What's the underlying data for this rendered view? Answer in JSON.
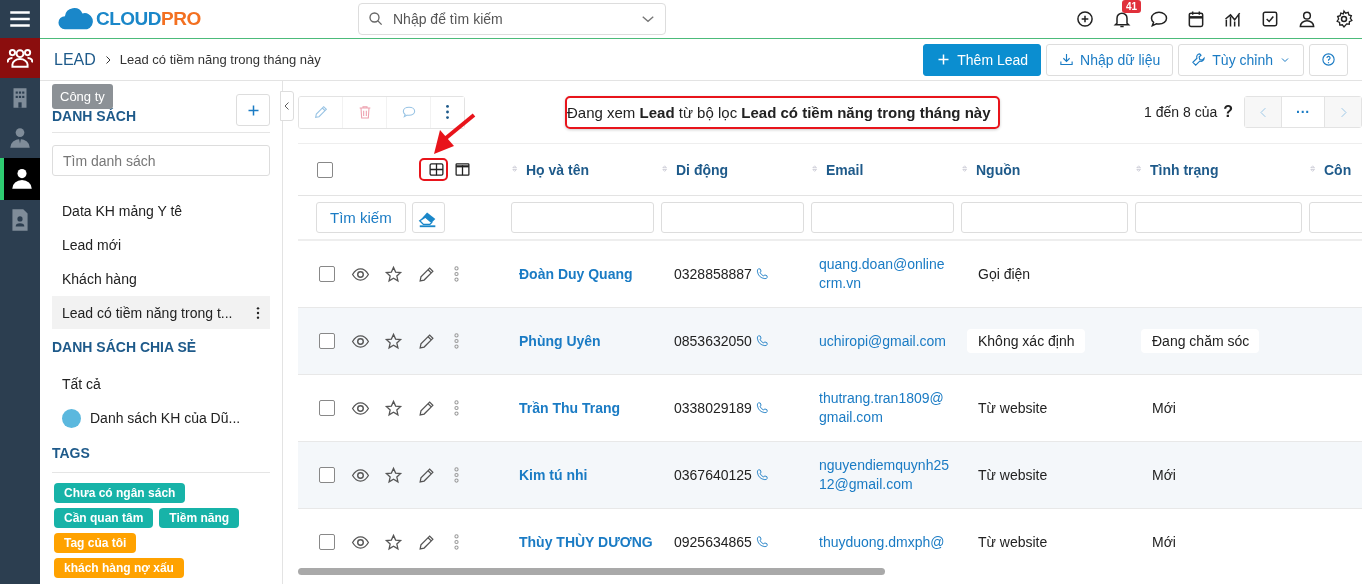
{
  "rail": [
    {
      "kind": "menu",
      "selected": false
    },
    {
      "kind": "leads",
      "selected": false,
      "highlighted": true
    },
    {
      "kind": "company",
      "selected": false
    },
    {
      "kind": "contact",
      "selected": false
    },
    {
      "kind": "person",
      "selected": true
    },
    {
      "kind": "document",
      "selected": false
    }
  ],
  "tooltip": "Công ty",
  "logo": {
    "text": "CLOUD",
    "accent": "PRO"
  },
  "search": {
    "placeholder": "Nhập để tìm kiếm"
  },
  "notifications": {
    "count": "41"
  },
  "breadcrumb": {
    "module": "LEAD",
    "current": "Lead có tiềm năng trong tháng này"
  },
  "actions": [
    {
      "kind": "add",
      "label": "Thêm Lead"
    },
    {
      "kind": "import",
      "label": "Nhập dữ liệu"
    },
    {
      "kind": "customize",
      "label": "Tùy chỉnh",
      "dropdown": true
    },
    {
      "kind": "help"
    }
  ],
  "sidebar": {
    "lists_title": "DANH SÁCH",
    "list_search": {
      "placeholder": "Tìm danh sách"
    },
    "lists": [
      {
        "label": "Data KH mảng Y tê",
        "selected": false
      },
      {
        "label": "Lead mới",
        "selected": false
      },
      {
        "label": "Khách hàng",
        "selected": false
      },
      {
        "label": "Lead có tiềm năng trong t...",
        "selected": true
      }
    ],
    "shared_title": "DANH SÁCH CHIA SẺ",
    "shared": [
      {
        "label": "Tất cả",
        "avatar": false
      },
      {
        "label": "Danh sách KH của Dũ...",
        "avatar": true
      }
    ],
    "tags_title": "TAGS",
    "tags": [
      {
        "label": "Chưa có ngân sách",
        "color": "#17b3a8"
      },
      {
        "label": "Cần quan tâm",
        "color": "#17b3a8"
      },
      {
        "label": "Tiềm năng",
        "color": "#17b3a8"
      },
      {
        "label": "Tag của tôi",
        "color": "#ffa200"
      },
      {
        "label": "khách hàng nợ xấu",
        "color": "#ffa200"
      }
    ]
  },
  "toolbar": [
    {
      "kind": "edit",
      "disabled": true
    },
    {
      "kind": "delete",
      "disabled": true
    },
    {
      "kind": "comment",
      "disabled": true
    },
    {
      "kind": "more",
      "disabled": false
    }
  ],
  "filter_message": "Đang xem **Lead** từ bộ lọc **Lead có tiềm năng trong tháng này**",
  "pagination": {
    "range": "1 đến 8 của",
    "total": "?",
    "more": "···"
  },
  "table": {
    "search_button": "Tìm kiếm",
    "select_all_checked": false,
    "columns": [
      {
        "label": "Họ và tên"
      },
      {
        "label": "Di động"
      },
      {
        "label": "Email"
      },
      {
        "label": "Nguồn"
      },
      {
        "label": "Tình trạng"
      },
      {
        "label": "Côn"
      }
    ],
    "rows": [
      {
        "checked": false,
        "name": "Đoàn Duy Quang",
        "phone": "0328858887",
        "email": "quang.doan@onlinecrm.vn",
        "source": "Gọi điện",
        "status": "",
        "boxed": false
      },
      {
        "checked": false,
        "name": "Phùng Uyên",
        "phone": "0853632050",
        "email": "uchiropi@gmail.com",
        "source": "Không xác định",
        "status": "Đang chăm sóc",
        "boxed": true
      },
      {
        "checked": false,
        "name": "Trần Thu Trang",
        "phone": "0338029189",
        "email": "thutrang.tran1809@gmail.com",
        "source": "Từ website",
        "status": "Mới",
        "boxed": false
      },
      {
        "checked": false,
        "name": "Kim tú nhi",
        "phone": "0367640125",
        "email": "nguyendiemquynh2512@gmail.com",
        "source": "Từ website",
        "status": "Mới",
        "boxed": false
      },
      {
        "checked": false,
        "name": "Thùy THÙY DƯƠNG",
        "phone": "0925634865",
        "email": "thuyduong.dmxph@",
        "source": "Từ website",
        "status": "Mới",
        "boxed": false
      }
    ]
  }
}
